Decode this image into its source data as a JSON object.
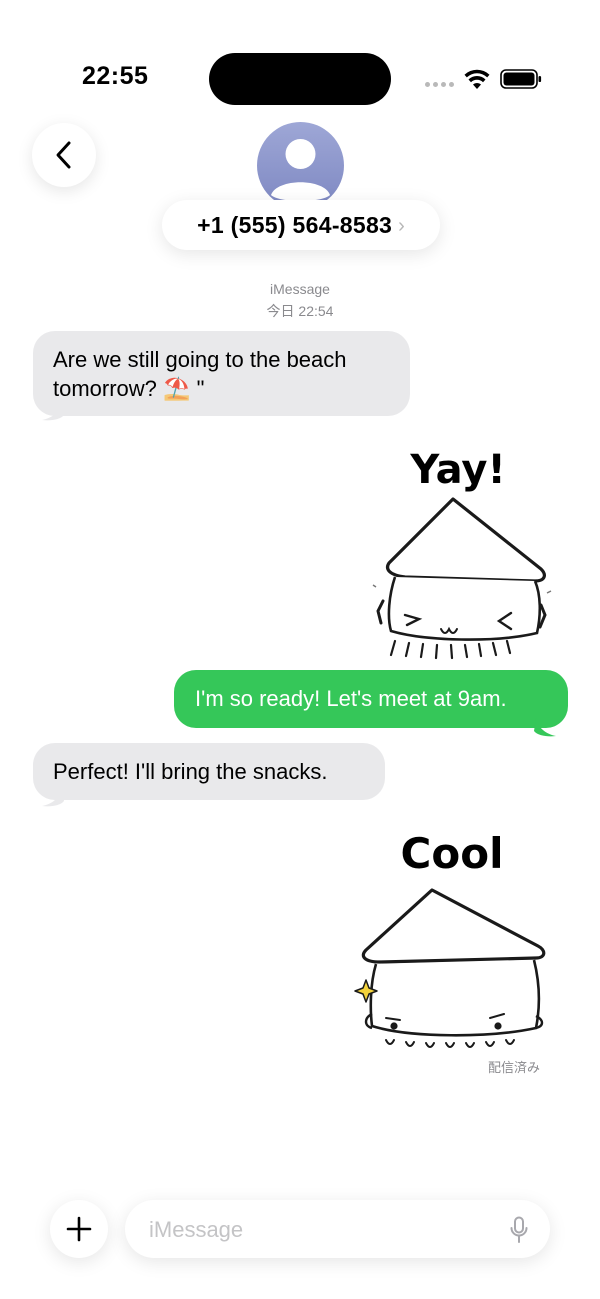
{
  "status_bar": {
    "time": "22:55"
  },
  "header": {
    "contact": "+1 (555) 564-8583",
    "chevron": "›",
    "icons": {
      "back": "chevron-left-icon",
      "avatar": "person-icon"
    }
  },
  "conversation": {
    "service": "iMessage",
    "timestamp": "今日 22:54",
    "messages": [
      {
        "type": "text",
        "direction": "incoming",
        "line1": "Are we still going to the beach",
        "line2_text": "tomorrow? ",
        "line2_emoji": "⛱️",
        "line2_tail": " \""
      },
      {
        "type": "sticker",
        "direction": "outgoing",
        "caption": "Yay!"
      },
      {
        "type": "text",
        "direction": "outgoing",
        "text": "I'm so ready! Let's meet at 9am."
      },
      {
        "type": "text",
        "direction": "incoming",
        "text": "Perfect! I'll bring the snacks."
      },
      {
        "type": "sticker",
        "direction": "outgoing",
        "caption": "Cool"
      }
    ],
    "delivered": "配信済み"
  },
  "composer": {
    "placeholder": "iMessage",
    "value": "",
    "icons": {
      "add": "plus-icon",
      "mic": "microphone-icon"
    }
  },
  "colors": {
    "outgoing_bubble": "#35c759",
    "incoming_bubble": "#e9e9eb",
    "avatar_gradient_top": "#9ea7d6",
    "avatar_gradient_bottom": "#7e88c2",
    "secondary_text": "#8a8a8e"
  }
}
